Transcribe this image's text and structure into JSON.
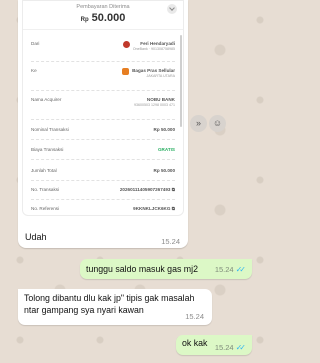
{
  "receipt": {
    "title": "Pembayaran Diterima",
    "currency": "Rp",
    "amount": "50.000",
    "from_label": "Dari",
    "from_name": "Feri Hendaryadi",
    "from_sub": "OneBank · 901308758985",
    "to_label": "Ke",
    "to_name": "Bagas Pras Sellular",
    "to_sub": "JAKARTA UTARA",
    "acquirer_label": "Nama Acquirer",
    "acquirer_value": "NOBU BANK",
    "acquirer_sub": "93600503 1298 0003 471",
    "nominal_label": "Nominal Transaksi",
    "nominal_value": "Rp 50.000",
    "fee_label": "Biaya Transaksi",
    "fee_value": "GRATIS",
    "total_label": "Jumlah Total",
    "total_value": "Rp 50.000",
    "trx_label": "No. Transaksi",
    "trx_value": "20260111405907267493",
    "ref_label": "No. Referensi",
    "ref_value": "9KKNKLJCK6KG"
  },
  "messages": [
    {
      "direction": "in",
      "text": "Udah",
      "time": "15.24"
    },
    {
      "direction": "out",
      "text": "tunggu saldo masuk gas mj2",
      "time": "15.24",
      "status": "read"
    },
    {
      "direction": "in",
      "text_line1": "Tolong dibantu dlu kak jp\" tipis gak masalah",
      "text_line2": "ntar gampang sya nyari kawan",
      "time": "15.24"
    },
    {
      "direction": "out",
      "text": "ok kak",
      "time": "15.24",
      "status": "read"
    }
  ],
  "icons": {
    "forward": "forward-icon",
    "react": "emoji-icon",
    "read_ticks": "double-check-icon",
    "copy": "copy-icon"
  },
  "colors": {
    "wallpaper": "#e7ddd3",
    "outgoing": "#dcf8c6",
    "incoming": "#ffffff",
    "ticks": "#34b7f1"
  }
}
